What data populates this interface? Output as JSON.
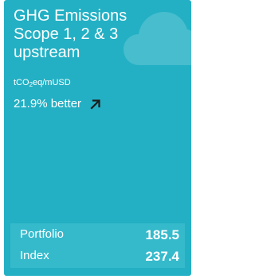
{
  "card": {
    "background_color": "#23b0c4",
    "panel_color": "#35bacc",
    "cloud_color": "#47bdcd",
    "title_lines": [
      "GHG Emissions",
      "Scope 1, 2 & 3",
      "upstream"
    ],
    "unit": {
      "prefix": "tCO",
      "subscript": "2",
      "suffix": "eq/mUSD"
    },
    "delta": {
      "text": "21.9% better",
      "icon": "arrow-up-right-icon"
    },
    "decoration_icon": "cloud-icon",
    "metrics": [
      {
        "label": "Portfolio",
        "value": "185.5"
      },
      {
        "label": "Index",
        "value": "237.4"
      }
    ]
  }
}
